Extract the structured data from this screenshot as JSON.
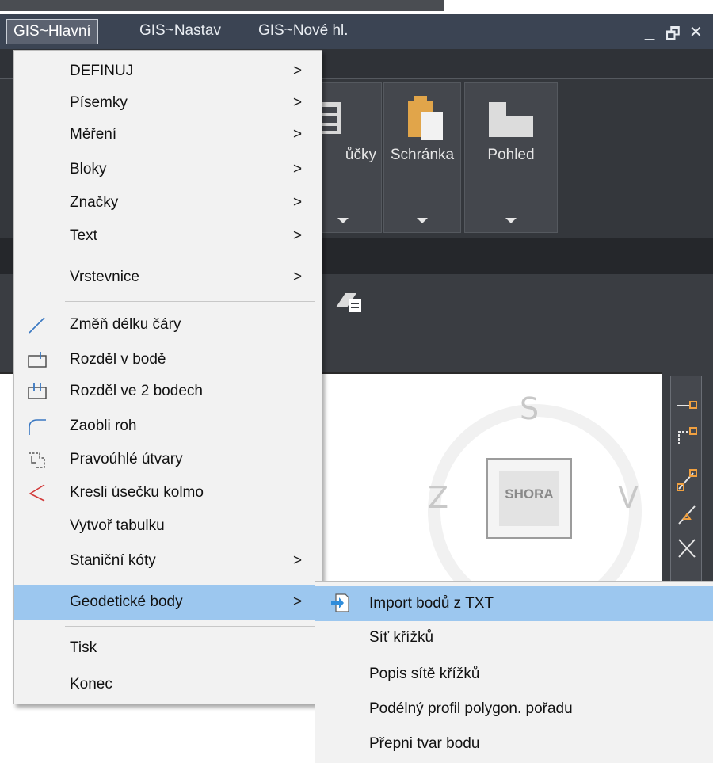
{
  "menubar": {
    "items": [
      "GIS~Hlavní",
      "GIS~Nastav",
      "GIS~Nové hl."
    ],
    "minimize_glyph": "_",
    "restore_glyph": "🗗",
    "close_glyph": "✕"
  },
  "ribbon": {
    "panels": [
      "ůčky",
      "Schránka",
      "Pohled"
    ]
  },
  "viewcube": {
    "north": "S",
    "west": "Z",
    "east": "V",
    "face": "SHORA"
  },
  "main_menu": {
    "items": [
      {
        "label": "DEFINUJ",
        "submenu": true,
        "icon": ""
      },
      {
        "label": "Písemky",
        "submenu": true,
        "icon": ""
      },
      {
        "label": "Měření",
        "submenu": true,
        "icon": ""
      },
      {
        "label": "Bloky",
        "submenu": true,
        "icon": ""
      },
      {
        "label": "Značky",
        "submenu": true,
        "icon": ""
      },
      {
        "label": "Text",
        "submenu": true,
        "icon": ""
      },
      {
        "label": "Vrstevnice",
        "submenu": true,
        "icon": ""
      },
      {
        "label": "Změň délku čáry",
        "submenu": false,
        "icon": "line-length-icon"
      },
      {
        "label": "Rozděl v bodě",
        "submenu": false,
        "icon": "split-point-icon"
      },
      {
        "label": "Rozděl ve 2 bodech",
        "submenu": false,
        "icon": "split-two-points-icon"
      },
      {
        "label": "Zaobli roh",
        "submenu": false,
        "icon": "fillet-icon"
      },
      {
        "label": "Pravoúhlé útvary",
        "submenu": false,
        "icon": "rectangular-shapes-icon"
      },
      {
        "label": "Kresli úsečku kolmo",
        "submenu": false,
        "icon": "perpendicular-line-icon"
      },
      {
        "label": "Vytvoř tabulku",
        "submenu": false,
        "icon": ""
      },
      {
        "label": "Staniční kóty",
        "submenu": true,
        "icon": ""
      },
      {
        "label": "Geodetické body",
        "submenu": true,
        "icon": "",
        "selected": true
      },
      {
        "label": "Tisk",
        "submenu": false,
        "icon": ""
      },
      {
        "label": "Konec",
        "submenu": false,
        "icon": ""
      }
    ],
    "chevron": ">"
  },
  "submenu": {
    "items": [
      {
        "label": "Import bodů z TXT",
        "icon": "import-txt-icon",
        "selected": true
      },
      {
        "label": "Síť křížků",
        "icon": ""
      },
      {
        "label": "Popis sítě křížků",
        "icon": ""
      },
      {
        "label": "Podélný profil polygon. pořadu",
        "icon": ""
      },
      {
        "label": "Přepni tvar bodu",
        "icon": ""
      }
    ]
  },
  "colors": {
    "menu_bg": "#f2f2f2",
    "highlight": "#9cc7ef",
    "menubar_bg": "#3b4453",
    "ribbon_bg": "#34373c"
  }
}
